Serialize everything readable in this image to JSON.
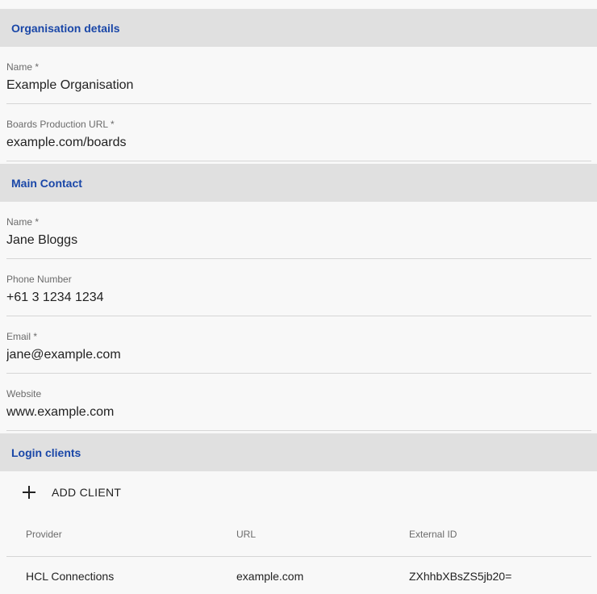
{
  "organisation": {
    "header": "Organisation details",
    "name_label": "Name *",
    "name_value": "Example Organisation",
    "url_label": "Boards Production URL *",
    "url_value": "example.com/boards"
  },
  "contact": {
    "header": "Main Contact",
    "name_label": "Name *",
    "name_value": "Jane Bloggs",
    "phone_label": "Phone Number",
    "phone_value": "+61 3 1234 1234",
    "email_label": "Email *",
    "email_value": "jane@example.com",
    "website_label": "Website",
    "website_value": "www.example.com"
  },
  "login_clients": {
    "header": "Login clients",
    "add_button_label": "ADD CLIENT",
    "add_icon": "plus-icon",
    "columns": [
      "Provider",
      "URL",
      "External ID"
    ],
    "rows": [
      {
        "provider": "HCL Connections",
        "url": "example.com",
        "external_id": "ZXhhbXBsZS5jb20="
      }
    ]
  },
  "colors": {
    "section_header_bg": "#e0e0e0",
    "section_header_text": "#1a47a8",
    "page_bg": "#f8f8f8"
  }
}
